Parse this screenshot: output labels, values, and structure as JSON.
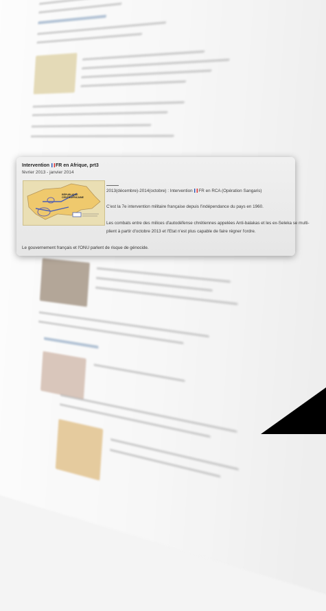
{
  "card": {
    "title_prefix": "Intervention",
    "title_suffix": "FR en Afrique, prt3",
    "date_range": "février 2013 - janvier 2014",
    "operation_prefix": "2013(décembre)-2014(octobre) : Intervention",
    "operation_suffix": "FR en RCA (Opération Sangaris)",
    "intro": "C'est la 7e intervention militaire française depuis l'indépendance du pays en 1960.",
    "combat_line1": "Les combats entre des milices d'autodéfense chrétiennes appelées Anti-balakas et les ex-Seleka se multi-",
    "combat_line2": "plient à partir d'octobre 2013 et l'Etat n'est plus capable de faire régner l'ordre.",
    "footer": "Le gouvernement français et l'ONU parlent de risque de génocide.",
    "map_label": "RÉPUBLIQUE CENTRAFRICAINE"
  },
  "colors": {
    "card_bg": "#eaeaea",
    "map_fill": "#e9dfb5",
    "flag_blue": "#2a55b0",
    "flag_red": "#d82a2a"
  }
}
